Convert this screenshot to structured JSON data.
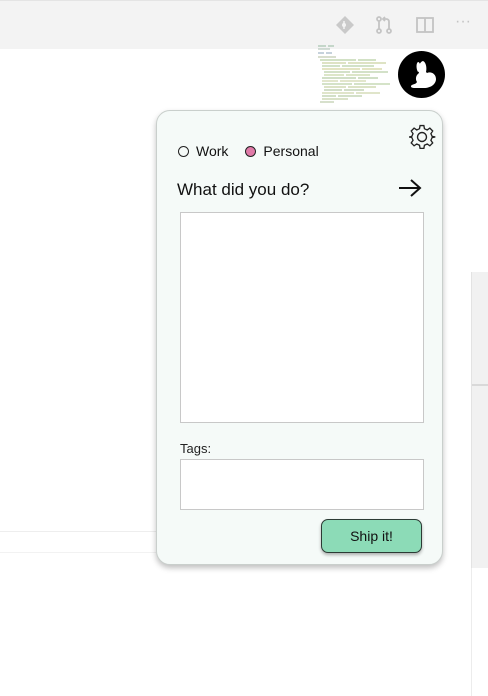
{
  "editor": {
    "toolbar_icons": [
      "git-diamond-icon",
      "pull-request-icon",
      "split-editor-icon",
      "more-icon"
    ],
    "more_label": "···"
  },
  "popup": {
    "logo_icon": "rabbit-logo-icon",
    "settings_icon": "gear-icon",
    "mode_options": [
      {
        "label": "Work",
        "selected": false
      },
      {
        "label": "Personal",
        "selected": true
      }
    ],
    "question": "What did you do?",
    "submit_icon": "arrow-right-icon",
    "entry_value": "",
    "tags_label": "Tags:",
    "tags_value": "",
    "ship_label": "Ship it!",
    "colors": {
      "card_bg": "#f5faf8",
      "accent_button": "#8cdbb7",
      "selected_radio": "#e07aa8"
    }
  }
}
